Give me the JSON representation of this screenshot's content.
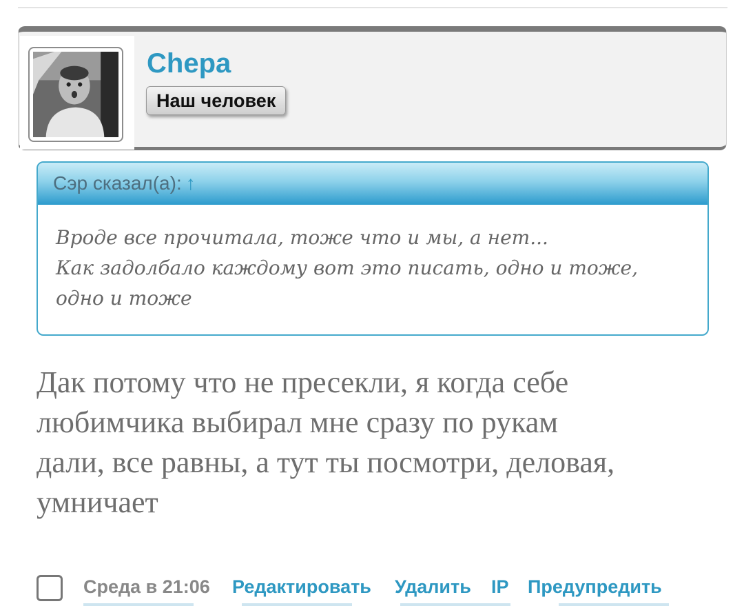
{
  "user": {
    "name": "Chepa",
    "rank": "Наш человек",
    "avatar_icon": "user-avatar-photo"
  },
  "quote": {
    "header": "Сэр сказал(а):",
    "arrow": "↑",
    "lines": [
      "Вроде все прочитала, тоже что и мы, а нет...",
      "Как задолбало каждому вот это писать, одно и тоже,",
      "одно и тоже"
    ]
  },
  "post": {
    "lines": [
      "Дак потому что не пресекли, я когда себе",
      "любимчика выбирал мне сразу по рукам",
      "дали, все равны, а тут ты посмотри, деловая,",
      "умничает"
    ]
  },
  "footer": {
    "date": "Среда в 21:06",
    "actions": {
      "edit": "Редактировать",
      "delete": "Удалить",
      "ip": "IP",
      "warn": "Предупредить"
    }
  },
  "colors": {
    "accent": "#2e98c2",
    "text_gray": "#6e6e6e",
    "card_border": "#7a7a7a"
  }
}
